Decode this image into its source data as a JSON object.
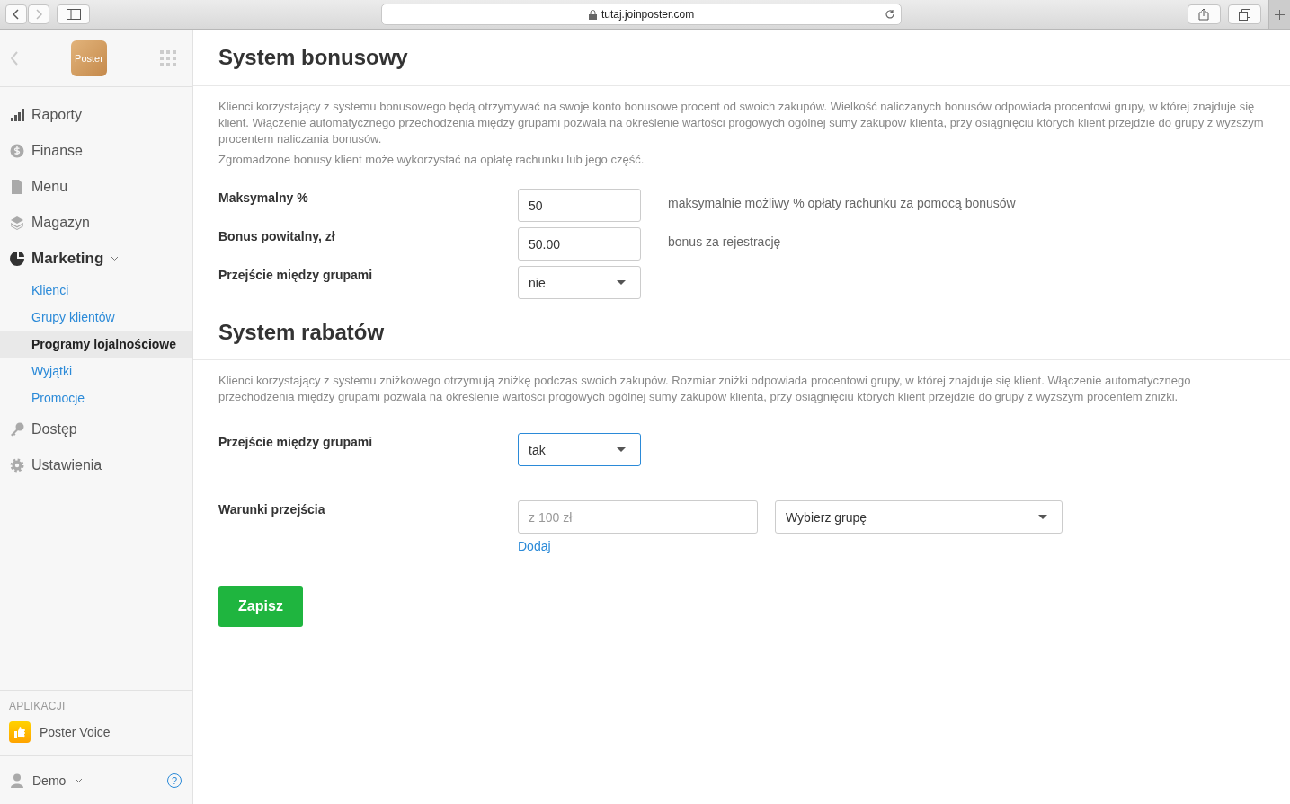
{
  "browser": {
    "url": "tutaj.joinposter.com"
  },
  "sidebar": {
    "logo": "Poster",
    "nav": [
      {
        "label": "Raporty",
        "kind": "bars"
      },
      {
        "label": "Finanse",
        "kind": "dollar"
      },
      {
        "label": "Menu",
        "kind": "file"
      },
      {
        "label": "Magazyn",
        "kind": "layers"
      },
      {
        "label": "Marketing",
        "kind": "pie",
        "expanded": true,
        "children": [
          {
            "label": "Klienci",
            "selected": false
          },
          {
            "label": "Grupy klientów",
            "selected": false
          },
          {
            "label": "Programy lojalnościowe",
            "selected": true
          },
          {
            "label": "Wyjątki",
            "selected": false
          },
          {
            "label": "Promocje",
            "selected": false
          }
        ]
      },
      {
        "label": "Dostęp",
        "kind": "key"
      },
      {
        "label": "Ustawienia",
        "kind": "gear"
      }
    ],
    "apps_heading": "APLIKACJI",
    "apps": [
      {
        "label": "Poster Voice"
      }
    ],
    "user": "Demo",
    "help": "?"
  },
  "sections": [
    {
      "title": "System bonusowy",
      "paragraphs": [
        "Klienci korzystający z systemu bonusowego będą otrzymywać na swoje konto bonusowe procent od swoich zakupów. Wielkość naliczanych bonusów odpowiada procentowi grupy, w której znajduje się klient. Włączenie automatycznego przechodzenia między grupami pozwala na określenie wartości progowych ogólnej sumy zakupów klienta, przy osiągnięciu których klient przejdzie do grupy z wyższym procentem naliczania bonusów.",
        "Zgromadzone bonusy klient może wykorzystać na opłatę rachunku lub jego część."
      ],
      "fields": [
        {
          "label": "Maksymalny %",
          "kind": "input",
          "value": "50",
          "hint": "maksymalnie możliwy % opłaty rachunku za pomocą bonusów"
        },
        {
          "label": "Bonus powitalny, zł",
          "kind": "input",
          "value": "50.00",
          "hint": "bonus za rejestrację"
        },
        {
          "label": "Przejście między grupami",
          "kind": "select",
          "value": "nie",
          "focused": false
        }
      ]
    },
    {
      "title": "System rabatów",
      "paragraphs": [
        "Klienci korzystający z systemu zniżkowego otrzymują zniżkę podczas swoich zakupów. Rozmiar zniżki odpowiada procentowi grupy, w której znajduje się klient. Włączenie automatycznego przechodzenia między grupami pozwala na określenie wartości progowych ogólnej sumy zakupów klienta, przy osiągnięciu których klient przejdzie do grupy z wyższym procentem zniżki."
      ],
      "fields": [
        {
          "label": "Przejście między grupami",
          "kind": "select",
          "value": "tak",
          "focused": true
        }
      ]
    }
  ],
  "conditions": {
    "label": "Warunki przejścia",
    "amount_placeholder": "z 100 zł",
    "group_select": "Wybierz grupę",
    "add_link": "Dodaj"
  },
  "save_button": "Zapisz"
}
